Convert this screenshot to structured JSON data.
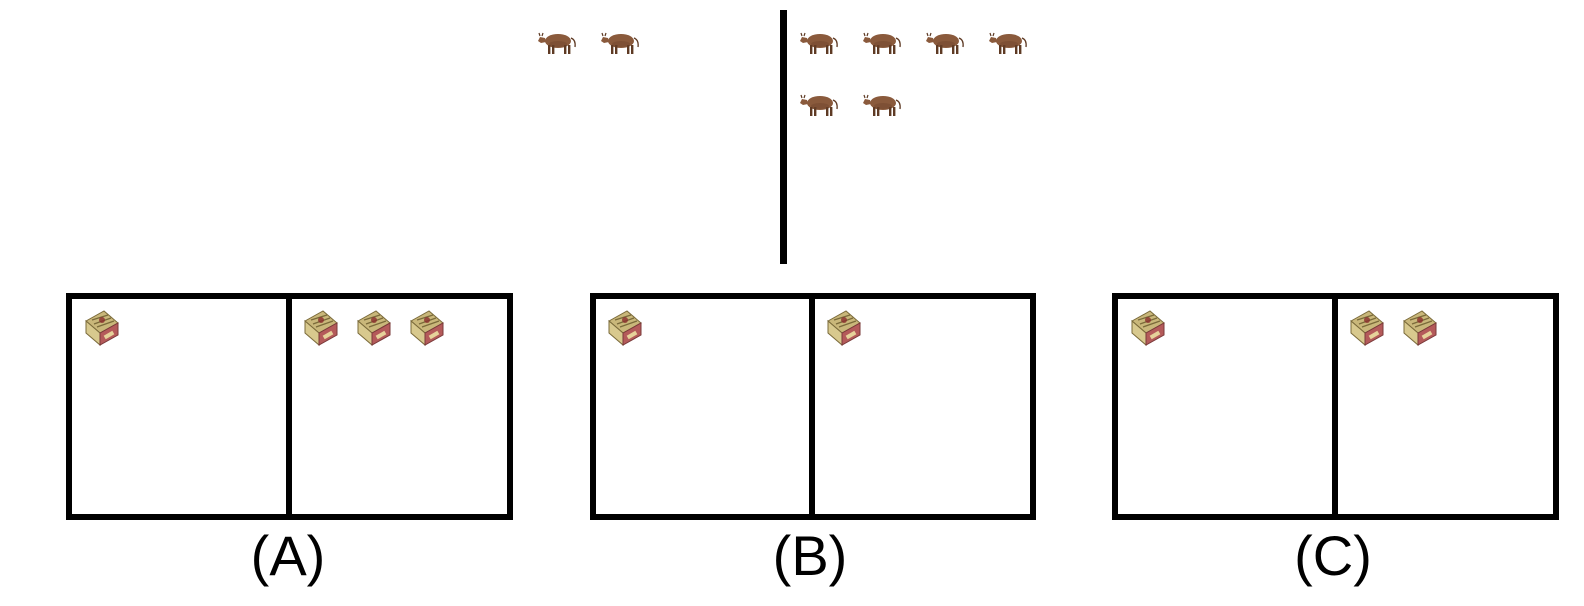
{
  "top": {
    "left_group": {
      "item": "cow-icon",
      "count": 2
    },
    "right_group": {
      "item": "cow-icon",
      "count": 6
    }
  },
  "options": [
    {
      "label": "(A)",
      "left_count": 1,
      "right_count": 3,
      "item": "butter-box-icon"
    },
    {
      "label": "(B)",
      "left_count": 1,
      "right_count": 1,
      "item": "butter-box-icon"
    },
    {
      "label": "(C)",
      "left_count": 1,
      "right_count": 2,
      "item": "butter-box-icon"
    }
  ],
  "colors": {
    "line": "#000000",
    "cow_body": "#8a5a3c",
    "cow_dark": "#5e3a24",
    "box_top": "#c9b77a",
    "box_side": "#b45a5a",
    "box_front": "#d8c98e",
    "box_stripe": "#7a6a3a"
  }
}
